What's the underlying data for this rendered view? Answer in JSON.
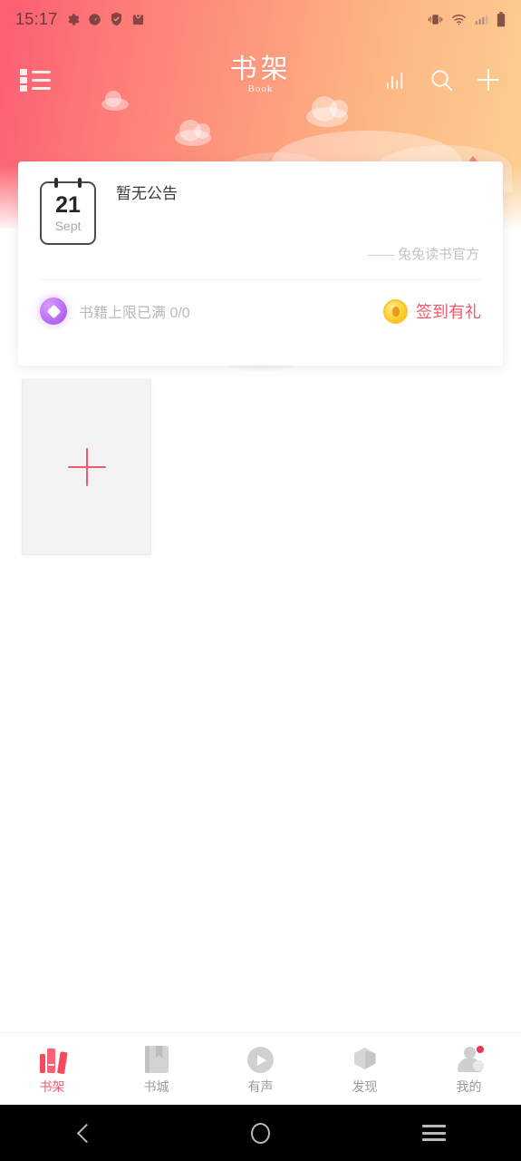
{
  "status_bar": {
    "time": "15:17",
    "left_icons": [
      "gear-icon",
      "speedometer-icon",
      "shield-icon",
      "bag-icon"
    ],
    "right_icons": [
      "vibrate-icon",
      "wifi-icon",
      "signal-icon",
      "battery-icon"
    ]
  },
  "header": {
    "title_cn": "书架",
    "title_en": "Book",
    "menu_icon": "list-menu-icon",
    "actions": [
      {
        "name": "ranking-icon",
        "label": "排行"
      },
      {
        "name": "search-icon",
        "label": "搜索"
      },
      {
        "name": "plus-icon",
        "label": "添加"
      }
    ]
  },
  "announcement": {
    "date_day": "21",
    "date_month": "Sept",
    "title": "暂无公告",
    "signature": "—— 兔兔读书官方",
    "limit_text": "书籍上限已满 0/0",
    "signin_label": "签到有礼",
    "signin_color": "#f3566b",
    "diamond_color": "#b066ef",
    "coin_color": "#ffd234"
  },
  "shelf": {
    "add_tile_label": "+"
  },
  "tabbar": {
    "items": [
      {
        "label": "书架",
        "icon": "books-icon",
        "active": true,
        "badge": false
      },
      {
        "label": "书城",
        "icon": "bookstore-icon",
        "active": false,
        "badge": false
      },
      {
        "label": "有声",
        "icon": "audio-play-icon",
        "active": false,
        "badge": false
      },
      {
        "label": "发现",
        "icon": "cube-discover-icon",
        "active": false,
        "badge": false
      },
      {
        "label": "我的",
        "icon": "avatar-icon",
        "active": false,
        "badge": true
      }
    ],
    "active_color": "#f3586c",
    "inactive_color": "#9a9a9a"
  },
  "system_nav": {
    "back": "back-icon",
    "home": "home-icon",
    "recents": "recents-icon"
  }
}
